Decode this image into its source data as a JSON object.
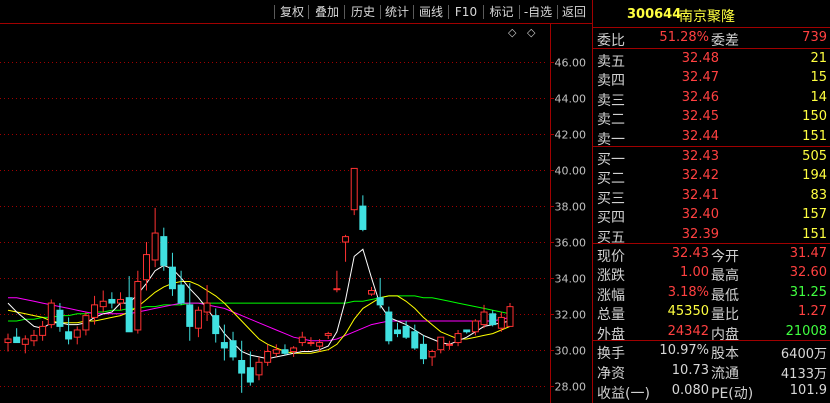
{
  "toolbar": {
    "buttons": [
      "复权",
      "叠加",
      "历史",
      "统计",
      "画线",
      "F10",
      "标记",
      "-自选",
      "返回"
    ]
  },
  "header": {
    "code": "300644",
    "name": "南京聚隆"
  },
  "commission": {
    "ratio_label": "委比",
    "ratio_value": "51.28%",
    "diff_label": "委差",
    "diff_value": "739"
  },
  "order_book": {
    "sell": [
      {
        "label": "卖五",
        "price": "32.48",
        "volume": "21"
      },
      {
        "label": "卖四",
        "price": "32.47",
        "volume": "15"
      },
      {
        "label": "卖三",
        "price": "32.46",
        "volume": "14"
      },
      {
        "label": "卖二",
        "price": "32.45",
        "volume": "150"
      },
      {
        "label": "卖一",
        "price": "32.44",
        "volume": "151"
      }
    ],
    "buy": [
      {
        "label": "买一",
        "price": "32.43",
        "volume": "505"
      },
      {
        "label": "买二",
        "price": "32.42",
        "volume": "194"
      },
      {
        "label": "买三",
        "price": "32.41",
        "volume": "83"
      },
      {
        "label": "买四",
        "price": "32.40",
        "volume": "157"
      },
      {
        "label": "买五",
        "price": "32.39",
        "volume": "151"
      }
    ]
  },
  "quote": [
    {
      "l1": "现价",
      "v1": "32.43",
      "c1": "#ff4040",
      "l2": "今开",
      "v2": "31.47",
      "c2": "#ff4040"
    },
    {
      "l1": "涨跌",
      "v1": "1.00",
      "c1": "#ff4040",
      "l2": "最高",
      "v2": "32.60",
      "c2": "#ff4040"
    },
    {
      "l1": "涨幅",
      "v1": "3.18%",
      "c1": "#ff4040",
      "l2": "最低",
      "v2": "31.25",
      "c2": "#40ff40"
    },
    {
      "l1": "总量",
      "v1": "45350",
      "c1": "#ffff40",
      "l2": "量比",
      "v2": "1.27",
      "c2": "#ff4040"
    },
    {
      "l1": "外盘",
      "v1": "24342",
      "c1": "#ff4040",
      "l2": "内盘",
      "v2": "21008",
      "c2": "#40ff40"
    }
  ],
  "fundamentals": [
    {
      "l1": "换手",
      "v1": "10.97%",
      "l2": "股本",
      "v2": "6400万"
    },
    {
      "l1": "净资",
      "v1": "10.73",
      "l2": "流通",
      "v2": "4133万"
    },
    {
      "l1": "收益(一)",
      "v1": "0.080",
      "l2": "PE(动)",
      "v2": "101.9"
    }
  ],
  "colors": {
    "up": "#ff3232",
    "down": "#40e0e0",
    "ma5": "#ffffff",
    "ma10": "#ffff00",
    "ma20": "#ff00ff",
    "ma60": "#00ff00",
    "grid": "#a00000"
  },
  "chart_data": {
    "type": "candlestick",
    "ylim": [
      27.2,
      48.2
    ],
    "yticks": [
      "46.00",
      "44.00",
      "42.00",
      "40.00",
      "38.00",
      "36.00",
      "34.00",
      "32.00",
      "30.00",
      "28.00"
    ],
    "candles": [
      [
        30.4,
        30.9,
        29.9,
        30.6
      ],
      [
        30.7,
        31.2,
        30.4,
        30.4
      ],
      [
        30.3,
        30.8,
        29.8,
        30.6
      ],
      [
        30.5,
        31.1,
        30.2,
        30.8
      ],
      [
        30.8,
        31.6,
        30.5,
        31.3
      ],
      [
        31.4,
        32.8,
        31.2,
        32.6
      ],
      [
        32.2,
        32.6,
        31.0,
        31.3
      ],
      [
        31.0,
        31.8,
        30.3,
        30.6
      ],
      [
        30.7,
        31.3,
        30.3,
        31.1
      ],
      [
        31.1,
        32.1,
        30.8,
        31.9
      ],
      [
        31.8,
        33.0,
        31.4,
        32.5
      ],
      [
        32.4,
        33.3,
        32.1,
        32.7
      ],
      [
        32.8,
        33.2,
        32.3,
        32.6
      ],
      [
        32.6,
        33.2,
        32.2,
        32.8
      ],
      [
        32.9,
        34.1,
        32.4,
        31.0
      ],
      [
        31.1,
        34.4,
        30.9,
        33.8
      ],
      [
        33.9,
        36.0,
        33.3,
        35.3
      ],
      [
        35.0,
        37.9,
        34.6,
        36.5
      ],
      [
        36.3,
        36.8,
        34.4,
        34.7
      ],
      [
        34.6,
        35.4,
        33.0,
        33.4
      ],
      [
        33.6,
        34.4,
        32.5,
        32.6
      ],
      [
        32.5,
        33.7,
        30.5,
        31.3
      ],
      [
        31.2,
        32.4,
        30.7,
        32.2
      ],
      [
        32.1,
        33.6,
        31.6,
        32.6
      ],
      [
        31.9,
        32.3,
        30.4,
        30.9
      ],
      [
        30.4,
        31.4,
        29.4,
        30.1
      ],
      [
        30.5,
        31.0,
        29.4,
        29.6
      ],
      [
        29.4,
        30.5,
        27.6,
        28.7
      ],
      [
        29.0,
        29.9,
        28.0,
        28.2
      ],
      [
        28.6,
        29.6,
        28.3,
        29.3
      ],
      [
        29.3,
        30.3,
        29.1,
        29.9
      ],
      [
        29.8,
        30.3,
        29.6,
        30.0
      ],
      [
        30.0,
        30.3,
        29.7,
        29.8
      ],
      [
        29.9,
        30.2,
        29.6,
        30.1
      ],
      [
        30.4,
        31.0,
        30.2,
        30.7
      ],
      [
        30.4,
        30.7,
        30.2,
        30.4
      ],
      [
        30.2,
        30.6,
        29.9,
        30.4
      ],
      [
        30.8,
        31.0,
        30.6,
        30.9
      ],
      [
        33.4,
        34.4,
        33.2,
        33.4
      ],
      [
        36.0,
        36.4,
        34.9,
        36.3
      ],
      [
        37.8,
        40.1,
        37.5,
        40.1
      ],
      [
        38.0,
        38.6,
        36.6,
        36.7
      ],
      [
        33.1,
        33.5,
        33.0,
        33.3
      ],
      [
        32.9,
        34.0,
        32.3,
        32.5
      ],
      [
        32.1,
        32.4,
        30.3,
        30.5
      ],
      [
        31.1,
        31.5,
        30.7,
        30.9
      ],
      [
        31.3,
        31.6,
        30.6,
        30.7
      ],
      [
        31.0,
        31.4,
        30.0,
        30.1
      ],
      [
        30.3,
        30.8,
        29.2,
        29.5
      ],
      [
        29.6,
        30.0,
        29.1,
        29.9
      ],
      [
        30.0,
        30.7,
        29.8,
        30.7
      ],
      [
        30.3,
        30.5,
        30.0,
        30.3
      ],
      [
        30.4,
        31.1,
        30.2,
        30.9
      ],
      [
        31.1,
        31.1,
        30.9,
        31.0
      ],
      [
        31.0,
        31.7,
        30.8,
        31.6
      ],
      [
        31.4,
        32.5,
        31.2,
        32.1
      ],
      [
        32.0,
        32.2,
        31.3,
        31.4
      ],
      [
        31.2,
        32.1,
        31.0,
        31.8
      ],
      [
        31.3,
        32.6,
        31.3,
        32.4
      ]
    ],
    "ma5": [
      32.6,
      32.1,
      31.7,
      31.3,
      31.2,
      31.5,
      31.5,
      31.4,
      31.4,
      31.5,
      31.8,
      32.0,
      32.1,
      32.6,
      32.6,
      33.1,
      33.7,
      34.4,
      34.7,
      34.5,
      34.0,
      33.4,
      32.9,
      32.3,
      31.6,
      30.9,
      30.4,
      29.9,
      29.7,
      29.6,
      29.5,
      29.6,
      29.7,
      29.8,
      29.9,
      29.9,
      30.0,
      30.2,
      31.0,
      32.8,
      35.2,
      35.6,
      34.0,
      32.5,
      31.8,
      31.6,
      31.4,
      31.1,
      30.8,
      30.6,
      30.4,
      30.3,
      30.5,
      30.7,
      31.0,
      31.3,
      31.4,
      31.5,
      31.6
    ],
    "ma10": [
      32.2,
      32.1,
      32.0,
      31.9,
      31.8,
      31.6,
      31.5,
      31.5,
      31.5,
      31.6,
      31.6,
      31.7,
      31.8,
      31.9,
      32.1,
      32.4,
      32.8,
      33.2,
      33.5,
      33.7,
      33.8,
      33.8,
      33.6,
      33.3,
      33.0,
      32.6,
      32.1,
      31.6,
      31.1,
      30.6,
      30.3,
      30.1,
      29.9,
      29.8,
      29.8,
      29.8,
      29.9,
      30.0,
      30.3,
      30.9,
      31.7,
      32.3,
      32.6,
      32.9,
      33.0,
      33.0,
      32.7,
      32.3,
      31.8,
      31.4,
      31.0,
      30.8,
      30.6,
      30.6,
      30.7,
      30.8,
      30.9,
      31.1,
      31.3
    ],
    "ma20": [
      32.9,
      32.9,
      32.8,
      32.7,
      32.6,
      32.5,
      32.4,
      32.3,
      32.2,
      32.1,
      32.0,
      32.0,
      32.0,
      32.0,
      32.0,
      32.1,
      32.2,
      32.3,
      32.4,
      32.5,
      32.6,
      32.6,
      32.6,
      32.5,
      32.4,
      32.3,
      32.1,
      31.9,
      31.7,
      31.5,
      31.3,
      31.1,
      30.9,
      30.7,
      30.6,
      30.5,
      30.5,
      30.5,
      30.6,
      30.8,
      31.0,
      31.2,
      31.4,
      31.5,
      31.6,
      31.6,
      31.6,
      31.6,
      31.6,
      31.6,
      31.6,
      31.6,
      31.6,
      31.6,
      31.6,
      31.6,
      31.6,
      31.7,
      31.8
    ],
    "ma60": [
      31.6,
      31.6,
      31.7,
      31.7,
      31.8,
      31.8,
      31.9,
      31.9,
      32.0,
      32.0,
      32.1,
      32.1,
      32.2,
      32.2,
      32.3,
      32.3,
      32.4,
      32.4,
      32.5,
      32.5,
      32.5,
      32.6,
      32.6,
      32.6,
      32.6,
      32.6,
      32.6,
      32.6,
      32.6,
      32.6,
      32.6,
      32.6,
      32.6,
      32.6,
      32.6,
      32.6,
      32.6,
      32.6,
      32.6,
      32.6,
      32.7,
      32.7,
      32.8,
      32.9,
      33.0,
      33.0,
      33.0,
      33.0,
      32.9,
      32.9,
      32.8,
      32.7,
      32.6,
      32.5,
      32.4,
      32.3,
      32.2,
      32.1,
      32.0
    ]
  }
}
